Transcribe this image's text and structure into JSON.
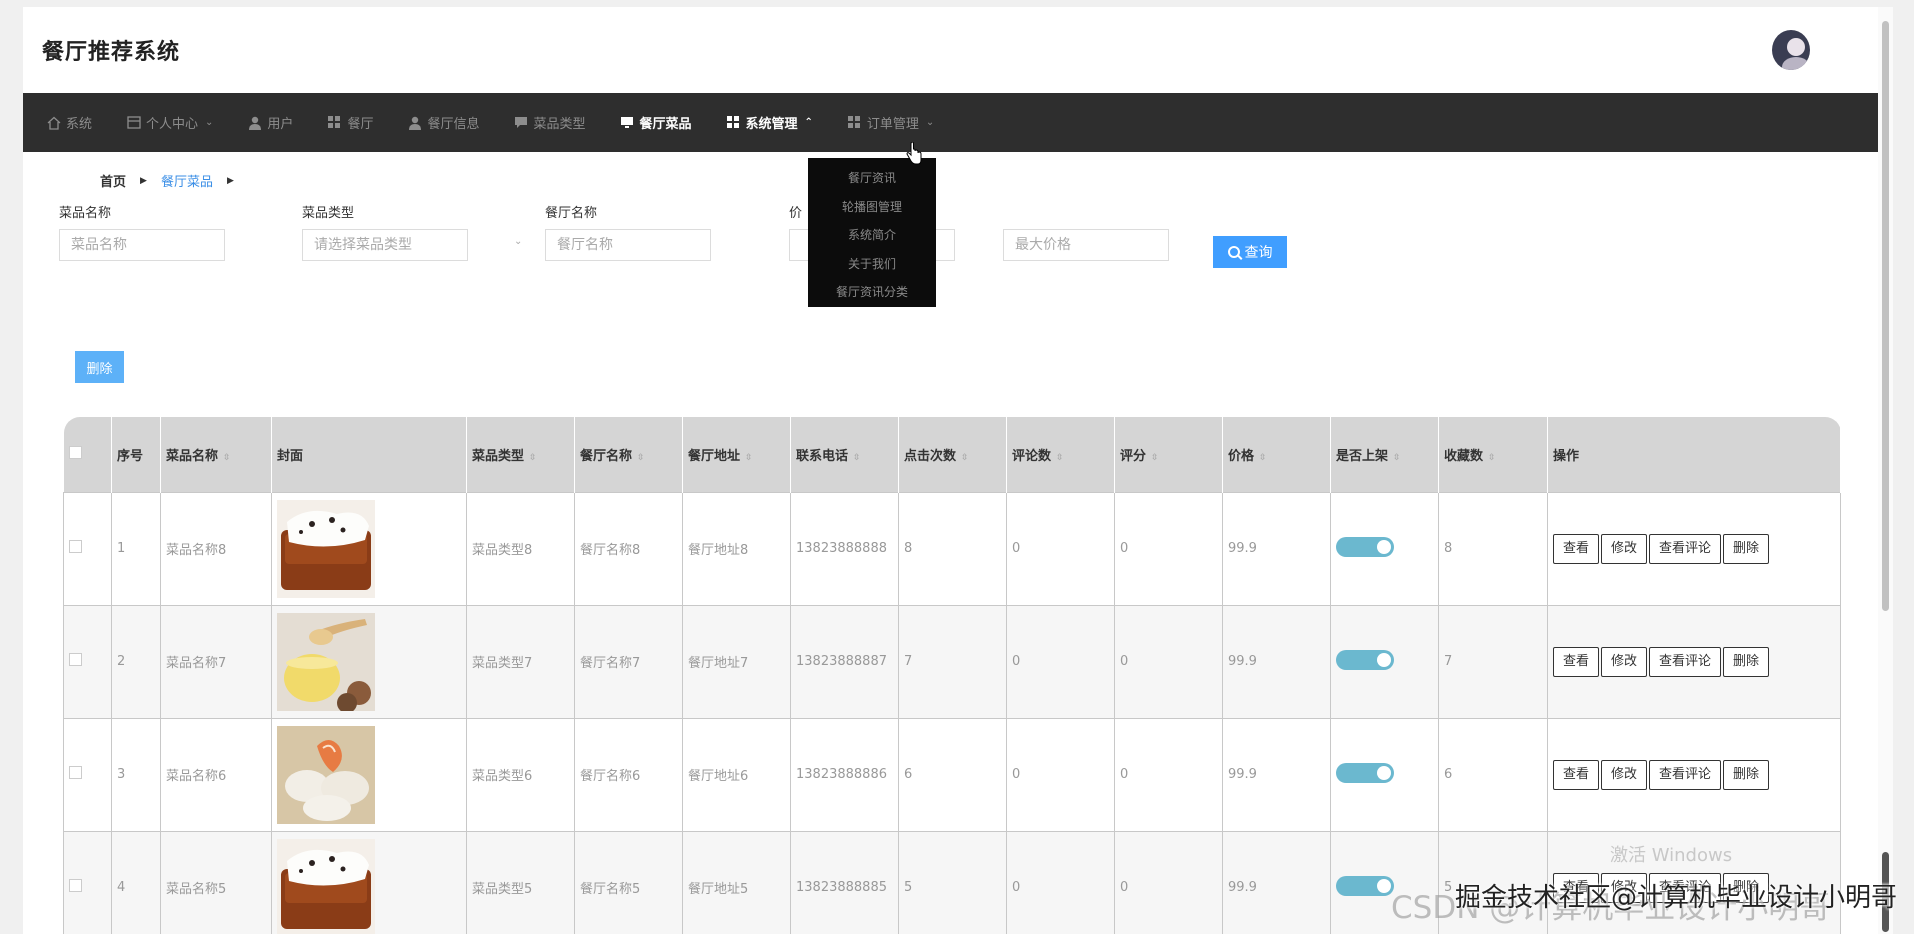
{
  "app": {
    "title": "餐厅推荐系统"
  },
  "nav": {
    "items": [
      {
        "label": "系统",
        "icon": "home-icon",
        "chevron": ""
      },
      {
        "label": "个人中心",
        "icon": "card-icon",
        "chevron": "⌄"
      },
      {
        "label": "用户",
        "icon": "user-icon",
        "chevron": ""
      },
      {
        "label": "餐厅",
        "icon": "grid-icon",
        "chevron": ""
      },
      {
        "label": "餐厅信息",
        "icon": "user-icon",
        "chevron": ""
      },
      {
        "label": "菜品类型",
        "icon": "chat-icon",
        "chevron": ""
      },
      {
        "label": "餐厅菜品",
        "icon": "monitor-icon",
        "chevron": ""
      },
      {
        "label": "系统管理",
        "icon": "grid-icon",
        "chevron": "⌃"
      },
      {
        "label": "订单管理",
        "icon": "grid-icon",
        "chevron": "⌄"
      }
    ],
    "dropdown": [
      "餐厅资讯",
      "轮播图管理",
      "系统简介",
      "关于我们",
      "餐厅资讯分类"
    ]
  },
  "breadcrumb": {
    "home": "首页",
    "current": "餐厅菜品"
  },
  "search": {
    "dish_name_label": "菜品名称",
    "dish_name_placeholder": "菜品名称",
    "dish_type_label": "菜品类型",
    "dish_type_placeholder": "请选择菜品类型",
    "restaurant_label": "餐厅名称",
    "restaurant_placeholder": "餐厅名称",
    "price_label": "价",
    "min_price_placeholder": "",
    "max_price_placeholder": "最大价格",
    "query_label": "查询"
  },
  "delete_label": "删除",
  "table": {
    "headers": [
      "序号",
      "菜品名称",
      "封面",
      "菜品类型",
      "餐厅名称",
      "餐厅地址",
      "联系电话",
      "点击次数",
      "评论数",
      "评分",
      "价格",
      "是否上架",
      "收藏数",
      "操作"
    ],
    "actions": [
      "查看",
      "修改",
      "查看评论",
      "删除"
    ],
    "rows": [
      {
        "no": "1",
        "name": "菜品名称8",
        "type": "菜品类型8",
        "restaurant": "餐厅名称8",
        "address": "餐厅地址8",
        "phone": "13823888888",
        "clicks": "8",
        "comments": "0",
        "score": "0",
        "price": "99.9",
        "fav": "8",
        "img": "bread"
      },
      {
        "no": "2",
        "name": "菜品名称7",
        "type": "菜品类型7",
        "restaurant": "餐厅名称7",
        "address": "餐厅地址7",
        "phone": "13823888887",
        "clicks": "7",
        "comments": "0",
        "score": "0",
        "price": "99.9",
        "fav": "7",
        "img": "honey"
      },
      {
        "no": "3",
        "name": "菜品名称6",
        "type": "菜品类型6",
        "restaurant": "餐厅名称6",
        "address": "餐厅地址6",
        "phone": "13823888886",
        "clicks": "6",
        "comments": "0",
        "score": "0",
        "price": "99.9",
        "fav": "6",
        "img": "dumpling"
      },
      {
        "no": "4",
        "name": "菜品名称5",
        "type": "菜品类型5",
        "restaurant": "餐厅名称5",
        "address": "餐厅地址5",
        "phone": "13823888885",
        "clicks": "5",
        "comments": "0",
        "score": "0",
        "price": "99.9",
        "fav": "5",
        "img": "bread"
      }
    ]
  },
  "watermark": {
    "activate": "激活 Windows",
    "csdn": "CSDN @计算机毕业设计小明哥",
    "juejin": "掘金技术社区@计算机毕业设计小明哥"
  },
  "colors": {
    "nav_bg": "#2e2e2e",
    "primary": "#409eff",
    "switch_on": "#6bb8cf"
  }
}
